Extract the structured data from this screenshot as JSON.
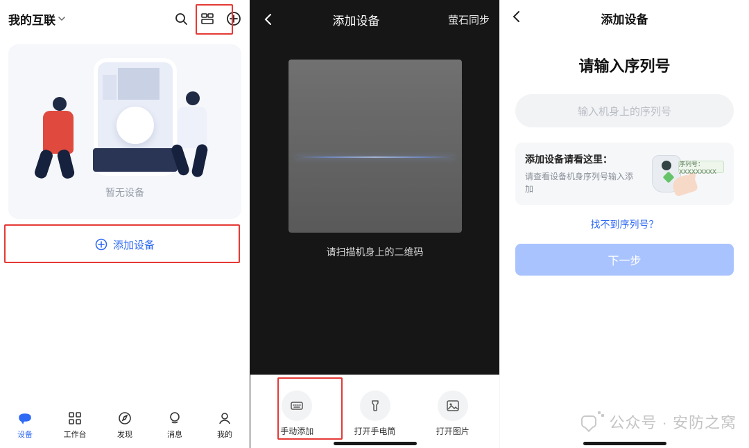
{
  "screen1": {
    "header": {
      "title": "我的互联",
      "search_icon": "search",
      "scan_icon": "scan",
      "add_icon": "plus"
    },
    "empty_text": "暂无设备",
    "add_button_label": "添加设备",
    "tabs": [
      {
        "label": "设备",
        "active": true
      },
      {
        "label": "工作台",
        "active": false
      },
      {
        "label": "发现",
        "active": false
      },
      {
        "label": "消息",
        "active": false
      },
      {
        "label": "我的",
        "active": false
      }
    ]
  },
  "screen2": {
    "header": {
      "title": "添加设备",
      "sync_label": "萤石同步"
    },
    "scan_hint": "请扫描机身上的二维码",
    "tools": [
      {
        "label": "手动添加",
        "icon": "keyboard"
      },
      {
        "label": "打开手电筒",
        "icon": "flashlight"
      },
      {
        "label": "打开图片",
        "icon": "image"
      }
    ]
  },
  "screen3": {
    "header_title": "添加设备",
    "heading": "请输入序列号",
    "input_placeholder": "输入机身上的序列号",
    "help": {
      "title": "添加设备请看这里：",
      "subtitle": "请查看设备机身序列号输入添加",
      "badge_text": "序列号：XXXXXXXXX"
    },
    "not_found_link": "找不到序列号？",
    "next_button": "下一步"
  },
  "watermark": {
    "text": "公众号 · 安防之窝"
  },
  "colors": {
    "primary": "#2f6af4",
    "highlight_red": "#e53935",
    "disabled_blue": "#a9c3ff"
  }
}
